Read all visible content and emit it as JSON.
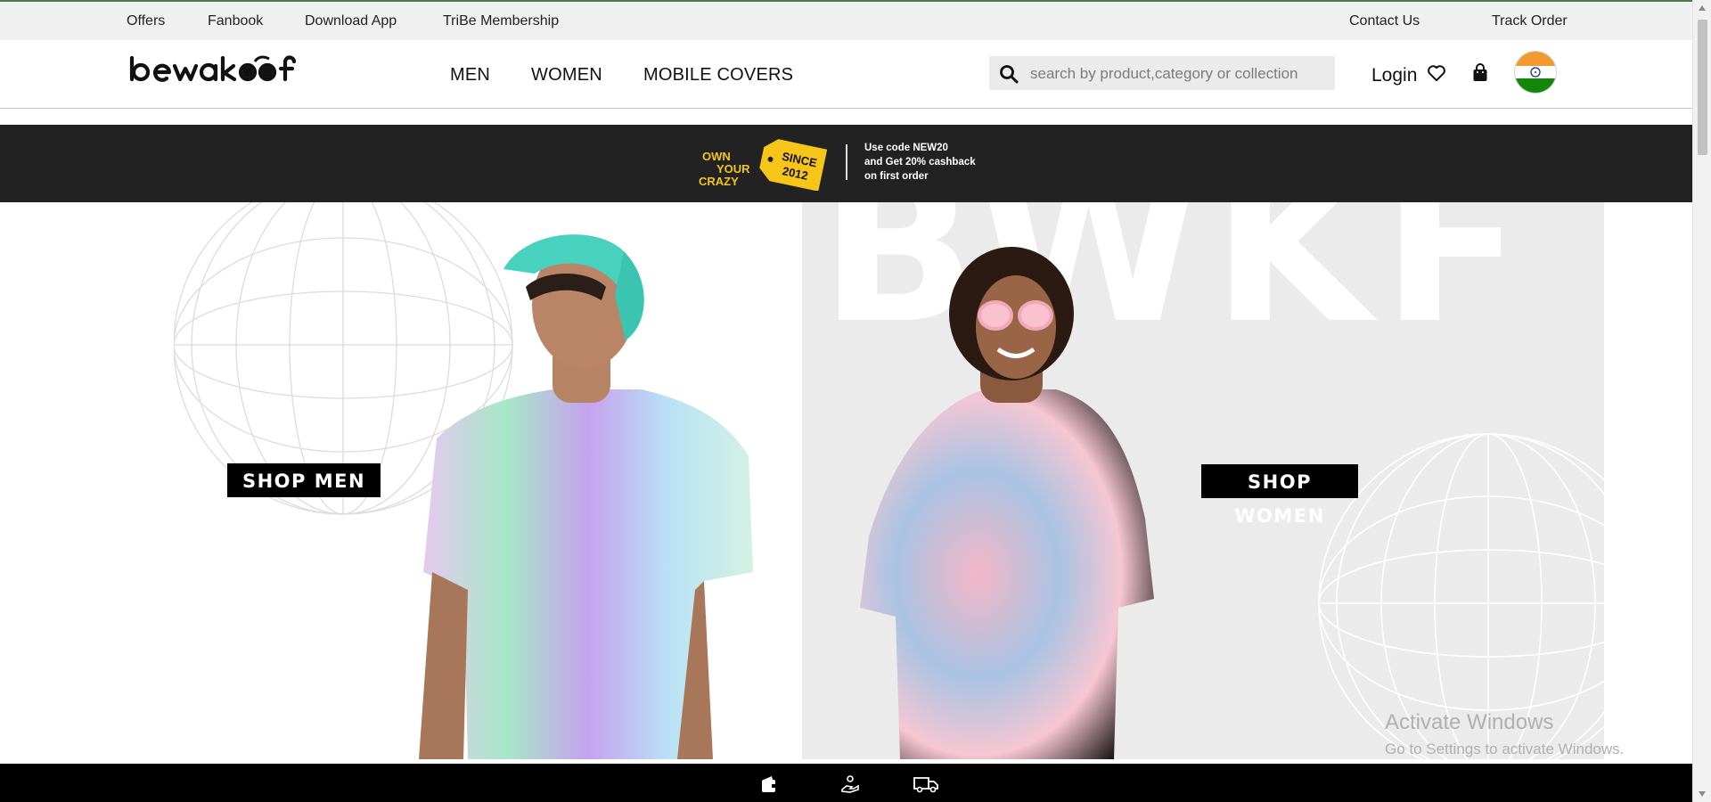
{
  "topbar": {
    "left_links": [
      "Offers",
      "Fanbook",
      "Download App",
      "TriBe Membership"
    ],
    "right_links": [
      "Contact Us",
      "Track Order"
    ]
  },
  "header": {
    "logo_text": "Bewakoof",
    "nav": [
      "MEN",
      "WOMEN",
      "MOBILE COVERS"
    ],
    "search": {
      "placeholder": "search by product,category or collection",
      "value": ""
    },
    "login_label": "Login",
    "icons": [
      "search-icon",
      "wishlist-heart-icon",
      "shopping-bag-icon",
      "india-flag-icon"
    ]
  },
  "promo": {
    "slogan_line1": "OWN",
    "slogan_line2": "YOUR",
    "slogan_line3": "CRAZY",
    "tag_line1": "SINCE",
    "tag_line2": "2012",
    "offer_line1_prefix": "Use code ",
    "offer_code": "NEW20",
    "offer_line2_prefix": "and ",
    "offer_line2_bold": "Get 20% cashback",
    "offer_line3": "on first order"
  },
  "hero": {
    "bg_text": "BWKF",
    "shop_men_label": "SHOP MEN",
    "shop_women_label": "SHOP WOMEN"
  },
  "watermark": {
    "line1": "Activate Windows",
    "line2": "Go to Settings to activate Windows."
  },
  "bottombar": {
    "icons": [
      "wallet-icon",
      "hand-coin-icon",
      "delivery-truck-icon"
    ]
  },
  "colors": {
    "topbar_bg": "#f0f0f0",
    "promo_bg": "#222222",
    "tag_yellow": "#f5c518",
    "hero_right_bg": "#ebebeb",
    "button_bg": "#000000"
  }
}
